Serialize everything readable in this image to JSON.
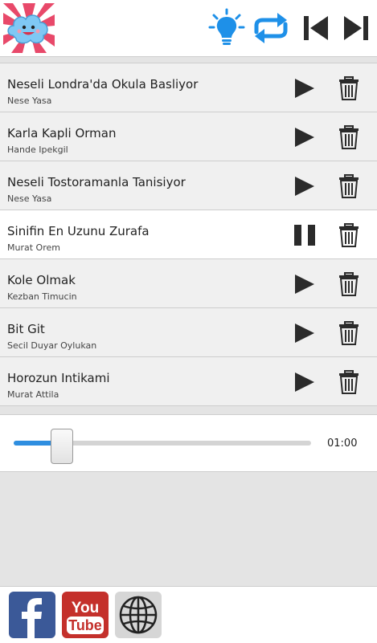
{
  "playlist": [
    {
      "title": "Neseli Londra'da Okula Basliyor",
      "artist": "Nese Yasa",
      "state": "play"
    },
    {
      "title": "Karla Kapli Orman",
      "artist": "Hande Ipekgil",
      "state": "play"
    },
    {
      "title": "Neseli Tostoramanla Tanisiyor",
      "artist": "Nese Yasa",
      "state": "play"
    },
    {
      "title": "Sinifin En Uzunu Zurafa",
      "artist": "Murat Orem",
      "state": "pause"
    },
    {
      "title": "Kole Olmak",
      "artist": "Kezban Timucin",
      "state": "play"
    },
    {
      "title": "Bit Git",
      "artist": "Secil Duyar Oylukan",
      "state": "play"
    },
    {
      "title": "Horozun Intikami",
      "artist": "Murat Attila",
      "state": "play"
    }
  ],
  "player": {
    "progress": 0.16,
    "time": "01:00"
  },
  "icons": {
    "toolbar": [
      "light-bulb-icon",
      "repeat-icon",
      "previous-icon",
      "next-icon"
    ],
    "social": [
      "facebook-icon",
      "youtube-icon",
      "globe-icon"
    ]
  },
  "social": {
    "youtube_top": "You",
    "youtube_bottom": "Tube"
  },
  "colors": {
    "accent": "#1e90e8",
    "control": "#2b2b2b",
    "facebook": "#3b5998",
    "youtube": "#c4302b"
  }
}
